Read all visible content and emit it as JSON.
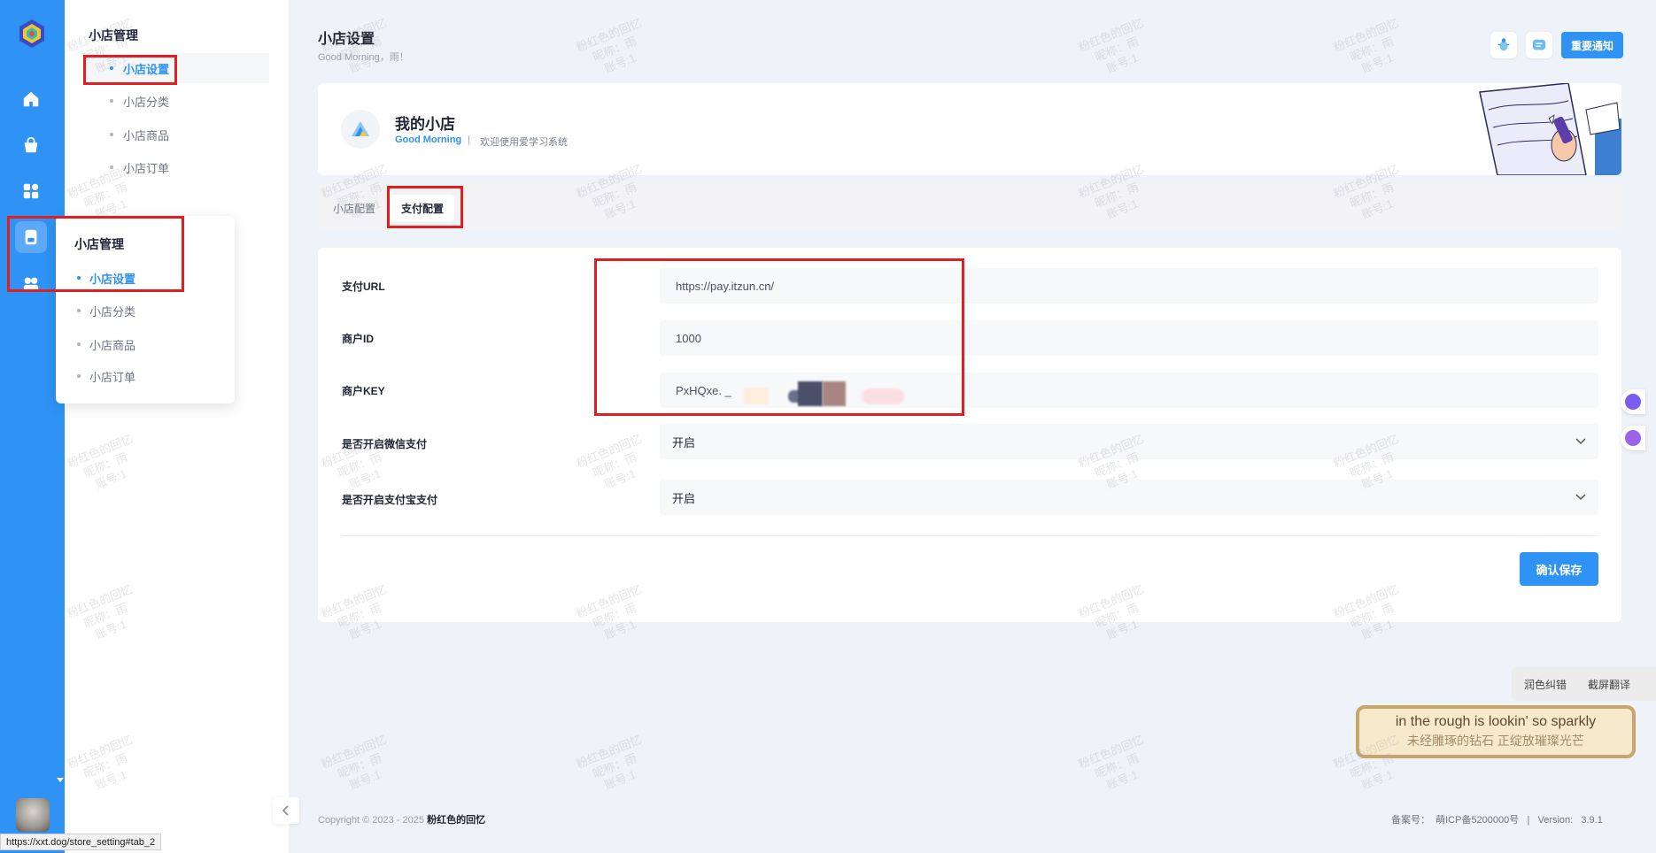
{
  "nav": {
    "icons": [
      "home-icon",
      "bag-icon",
      "apps-icon",
      "store-icon",
      "group-icon"
    ]
  },
  "submenu": {
    "title": "小店管理",
    "items": [
      {
        "label": "小店设置",
        "active": true
      },
      {
        "label": "小店分类",
        "active": false
      },
      {
        "label": "小店商品",
        "active": false
      },
      {
        "label": "小店订单",
        "active": false
      }
    ]
  },
  "flyout": {
    "title": "小店管理",
    "items": [
      {
        "label": "小店设置",
        "active": true
      },
      {
        "label": "小店分类",
        "active": false
      },
      {
        "label": "小店商品",
        "active": false
      },
      {
        "label": "小店订单",
        "active": false
      }
    ]
  },
  "header": {
    "title": "小店设置",
    "subtitle": "Good Morning，雨！",
    "notice_button": "重要通知"
  },
  "store": {
    "name": "我的小店",
    "greeting": "Good Morning",
    "separator": "|",
    "welcome": "欢迎使用爱学习系统"
  },
  "tabs": [
    {
      "label": "小店配置",
      "active": false
    },
    {
      "label": "支付配置",
      "active": true
    }
  ],
  "form": {
    "fields": [
      {
        "label": "支付URL",
        "value": "https://pay.itzun.cn/"
      },
      {
        "label": "商户ID",
        "value": "1000"
      },
      {
        "label": "商户KEY",
        "value": "PxHQxe. _"
      },
      {
        "label": "是否开启微信支付",
        "value": "开启"
      },
      {
        "label": "是否开启支付宝支付",
        "value": "开启"
      }
    ],
    "save_button": "确认保存"
  },
  "footer": {
    "copyright": "Copyright © 2023 - 2025",
    "owner": "粉红色的回忆",
    "beian": "备案号：  萌ICP备5200000号   |   Version:   3.9.1"
  },
  "overlay": {
    "translate_polish": "润色纠错",
    "translate_screen": "截屏翻译",
    "lyric_en": "in the rough is lookin' so sparkly",
    "lyric_zh": "未经雕琢的钻石 正绽放璀璨光芒"
  },
  "watermark": {
    "line1": "粉红色的回忆",
    "line2": "昵称：雨",
    "line3": "账号:1"
  },
  "status_url": "https://xxt.dog/store_setting#tab_2",
  "colors": {
    "primary": "#2f93f5",
    "background": "#eef3f9",
    "annotation": "#e02020"
  }
}
